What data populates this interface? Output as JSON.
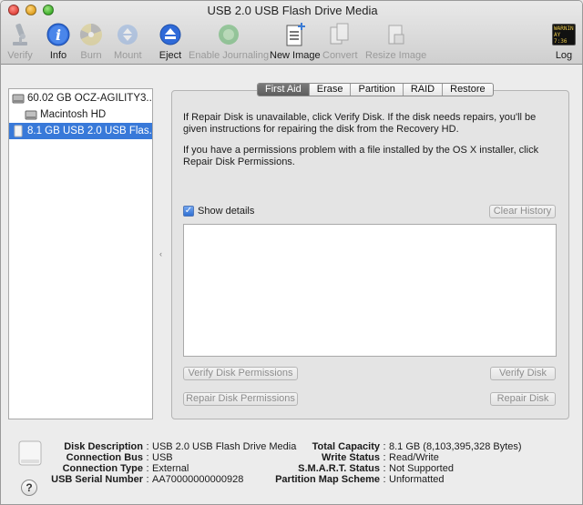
{
  "window": {
    "title": "USB 2.0 USB Flash Drive Media"
  },
  "toolbar": {
    "verify": "Verify",
    "info": "Info",
    "burn": "Burn",
    "mount": "Mount",
    "eject": "Eject",
    "enable_journaling": "Enable Journaling",
    "new_image": "New Image",
    "convert": "Convert",
    "resize_image": "Resize Image",
    "log": "Log",
    "log_icon_text_1": "WARNIN",
    "log_icon_text_2": "AY 7:36"
  },
  "sidebar": {
    "items": [
      {
        "label": "60.02 GB OCZ-AGILITY3..."
      },
      {
        "label": "Macintosh HD"
      },
      {
        "label": "8.1 GB USB 2.0 USB Flas..."
      }
    ]
  },
  "tabs": [
    {
      "label": "First Aid"
    },
    {
      "label": "Erase"
    },
    {
      "label": "Partition"
    },
    {
      "label": "RAID"
    },
    {
      "label": "Restore"
    }
  ],
  "first_aid": {
    "para1": "If Repair Disk is unavailable, click Verify Disk. If the disk needs repairs, you'll be given instructions for repairing the disk from the Recovery HD.",
    "para2": "If you have a permissions problem with a file installed by the OS X installer, click Repair Disk Permissions.",
    "show_details": "Show details",
    "clear_history": "Clear History",
    "verify_permissions": "Verify Disk Permissions",
    "verify_disk": "Verify Disk",
    "repair_permissions": "Repair Disk Permissions",
    "repair_disk": "Repair Disk"
  },
  "footer": {
    "left": [
      {
        "key": "Disk Description",
        "value": "USB 2.0 USB Flash Drive Media"
      },
      {
        "key": "Connection Bus",
        "value": "USB"
      },
      {
        "key": "Connection Type",
        "value": "External"
      },
      {
        "key": "USB Serial Number",
        "value": "AA70000000000928"
      }
    ],
    "right": [
      {
        "key": "Total Capacity",
        "value": "8.1 GB (8,103,395,328 Bytes)"
      },
      {
        "key": "Write Status",
        "value": "Read/Write"
      },
      {
        "key": "S.M.A.R.T. Status",
        "value": "Not Supported"
      },
      {
        "key": "Partition Map Scheme",
        "value": "Unformatted"
      }
    ],
    "help": "?"
  }
}
